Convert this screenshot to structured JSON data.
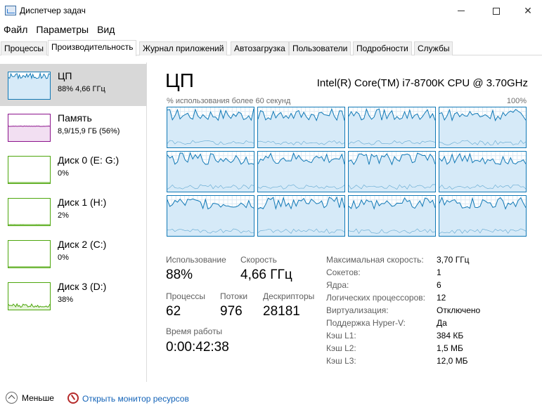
{
  "window": {
    "title": "Диспетчер задач",
    "icon": "task-manager-icon",
    "controls": [
      "minimize-icon",
      "maximize-icon",
      "close-icon"
    ]
  },
  "menu": [
    "Файл",
    "Параметры",
    "Вид"
  ],
  "tabs": [
    {
      "label": "Процессы",
      "active": false
    },
    {
      "label": "Производительность",
      "active": true
    },
    {
      "label": "Журнал приложений",
      "active": false
    },
    {
      "label": "Автозагрузка",
      "active": false
    },
    {
      "label": "Пользователи",
      "active": false
    },
    {
      "label": "Подробности",
      "active": false
    },
    {
      "label": "Службы",
      "active": false
    }
  ],
  "sidebar": {
    "items": [
      {
        "name": "ЦП",
        "sub": "88% 4,66 ГГц",
        "color": "#1179b6",
        "fill": "#d6eaf8",
        "selected": true
      },
      {
        "name": "Память",
        "sub": "8,9/15,9 ГБ (56%)",
        "color": "#8b128b",
        "fill": "#f2dff2",
        "selected": false
      },
      {
        "name": "Диск 0 (E: G:)",
        "sub": "0%",
        "color": "#4da60c",
        "fill": "#e6f4d9",
        "selected": false
      },
      {
        "name": "Диск 1 (H:)",
        "sub": "2%",
        "color": "#4da60c",
        "fill": "#e6f4d9",
        "selected": false
      },
      {
        "name": "Диск 2 (C:)",
        "sub": "0%",
        "color": "#4da60c",
        "fill": "#e6f4d9",
        "selected": false
      },
      {
        "name": "Диск 3 (D:)",
        "sub": "38%",
        "color": "#4da60c",
        "fill": "#e6f4d9",
        "selected": false
      }
    ]
  },
  "main": {
    "title": "ЦП",
    "cpu_model": "Intel(R) Core(TM) i7-8700K CPU @ 3.70GHz",
    "graph_label": "% использования более 60 секунд",
    "graph_max": "100%",
    "graph_color": "#1179b6",
    "graph_fill": "#d6eaf8",
    "logical_cpu_graph_count": 12
  },
  "stats": {
    "usage_label": "Использование",
    "usage_value": "88%",
    "speed_label": "Скорость",
    "speed_value": "4,66 ГГц",
    "processes_label": "Процессы",
    "processes_value": "62",
    "threads_label": "Потоки",
    "threads_value": "976",
    "handles_label": "Дескрипторы",
    "handles_value": "28181",
    "uptime_label": "Время работы",
    "uptime_value": "0:00:42:38"
  },
  "info": [
    {
      "key": "Максимальная скорость:",
      "value": "3,70 ГГц"
    },
    {
      "key": "Сокетов:",
      "value": "1"
    },
    {
      "key": "Ядра:",
      "value": "6"
    },
    {
      "key": "Логических процессоров:",
      "value": "12"
    },
    {
      "key": "Виртуализация:",
      "value": "Отключено"
    },
    {
      "key": "Поддержка Hyper-V:",
      "value": "Да"
    },
    {
      "key": "Кэш L1:",
      "value": "384 КБ"
    },
    {
      "key": "Кэш L2:",
      "value": "1,5 МБ"
    },
    {
      "key": "Кэш L3:",
      "value": "12,0 МБ"
    }
  ],
  "footer": {
    "fewer_label": "Меньше",
    "monitor_label": "Открыть монитор ресурсов"
  }
}
